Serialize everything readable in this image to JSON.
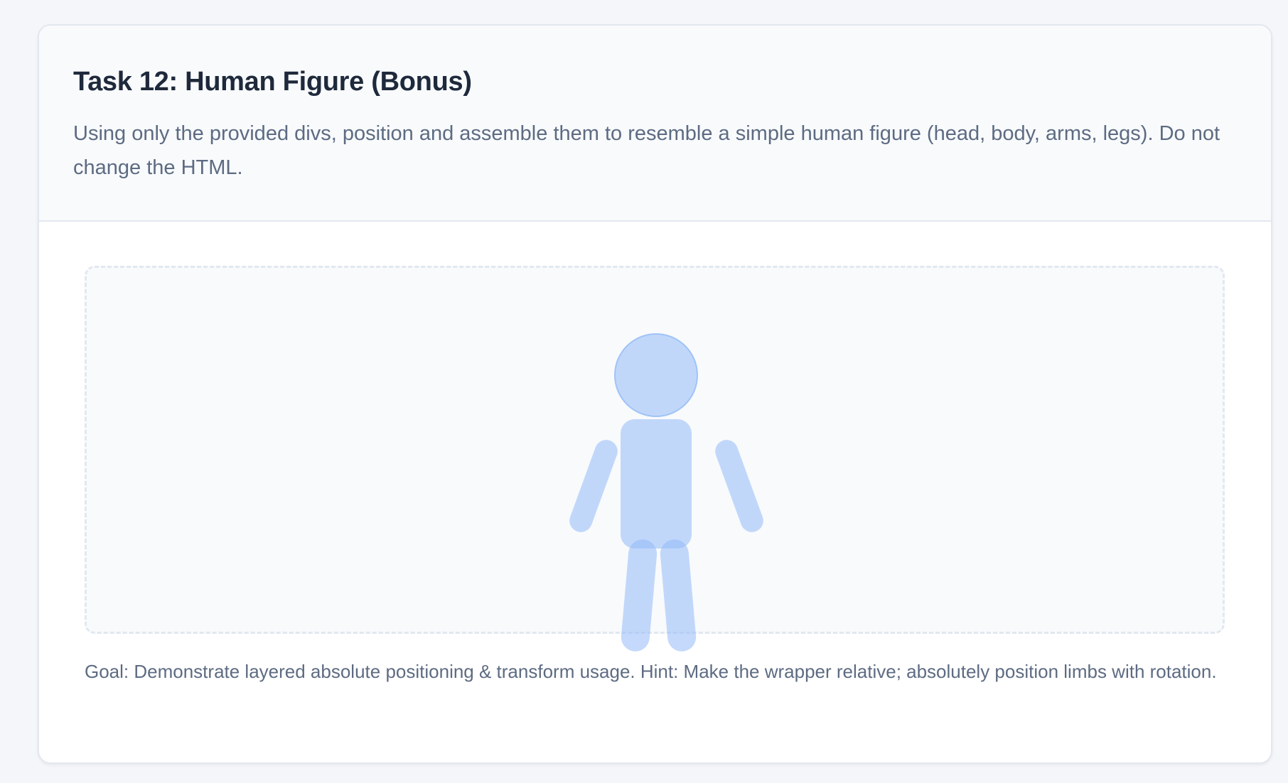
{
  "card": {
    "title": "Task 12: Human Figure (Bonus)",
    "description": "Using only the provided divs, position and assemble them to resemble a simple human figure (head, body, arms, legs). Do not change the HTML.",
    "goal": "Goal: Demonstrate layered absolute positioning & transform usage. Hint: Make the wrapper relative; absolutely position limbs with rotation."
  },
  "figure": {
    "color": "#93baf7",
    "parts": [
      "head",
      "torso",
      "left-arm",
      "right-arm",
      "left-leg",
      "right-leg"
    ]
  }
}
